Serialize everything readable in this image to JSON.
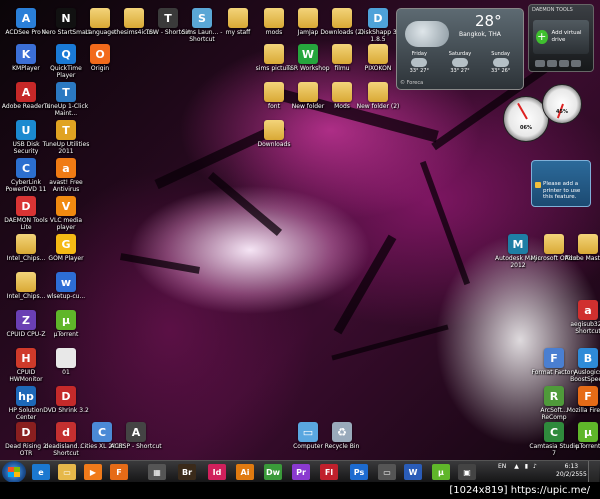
{
  "icons": [
    {
      "label": "ACDSee Pro 4",
      "color": "#2a7fd8",
      "glyph": "A"
    },
    {
      "label": "Nero StartSmart",
      "color": "#111",
      "glyph": "N"
    },
    {
      "label": "Language",
      "color": "folder",
      "glyph": ""
    },
    {
      "label": "thesims4icon",
      "color": "folder",
      "glyph": ""
    },
    {
      "label": "TSW - Shortcut",
      "color": "#3a3a3a",
      "glyph": "T"
    },
    {
      "label": "Sims Laun... - Shortcut",
      "color": "#5aa7d6",
      "glyph": "S"
    },
    {
      "label": "my staff",
      "color": "folder",
      "glyph": ""
    },
    {
      "label": "mods",
      "color": "folder",
      "glyph": ""
    },
    {
      "label": "JamJap",
      "color": "folder",
      "glyph": ""
    },
    {
      "label": "Downloads (2)",
      "color": "folder",
      "glyph": ""
    },
    {
      "label": "DiskShapp 3 1.8.5",
      "color": "#4ea2d9",
      "glyph": "D"
    },
    {
      "label": "KMPlayer",
      "color": "#3b6fd6",
      "glyph": "K"
    },
    {
      "label": "QuickTime Player",
      "color": "#1a7ad6",
      "glyph": "Q"
    },
    {
      "label": "Origin",
      "color": "#f26a1b",
      "glyph": "O"
    },
    {
      "label": "sims picture",
      "color": "folder",
      "glyph": ""
    },
    {
      "label": "TSR Workshop",
      "color": "#26a63d",
      "glyph": "W"
    },
    {
      "label": "filmu",
      "color": "folder",
      "glyph": ""
    },
    {
      "label": "PIXOKON",
      "color": "folder",
      "glyph": ""
    },
    {
      "label": "Adobe Reader X",
      "color": "#c62828",
      "glyph": "A"
    },
    {
      "label": "TuneUp 1-Click Maint...",
      "color": "#2b79c2",
      "glyph": "T"
    },
    {
      "label": "font",
      "color": "folder",
      "glyph": ""
    },
    {
      "label": "New folder",
      "color": "folder",
      "glyph": ""
    },
    {
      "label": "Mods",
      "color": "folder",
      "glyph": ""
    },
    {
      "label": "New folder (2)",
      "color": "folder",
      "glyph": ""
    },
    {
      "label": "USB Disk Security",
      "color": "#1b8ad0",
      "glyph": "U"
    },
    {
      "label": "TuneUp Utilities 2011",
      "color": "#e0a322",
      "glyph": "T"
    },
    {
      "label": "Downloads",
      "color": "folder",
      "glyph": ""
    },
    {
      "label": "CyberLink PowerDVD 11",
      "color": "#2c6fcf",
      "glyph": "C"
    },
    {
      "label": "avast! Free Antivirus",
      "color": "#f07b14",
      "glyph": "a"
    },
    {
      "label": "DAEMON Tools Lite",
      "color": "#d93434",
      "glyph": "D"
    },
    {
      "label": "VLC media player",
      "color": "#f18a10",
      "glyph": "V"
    },
    {
      "label": "Intel_Chips...",
      "color": "folder",
      "glyph": ""
    },
    {
      "label": "GOM Player",
      "color": "#f5b915",
      "glyph": "G"
    },
    {
      "label": "Intel_Chips...",
      "color": "folder",
      "glyph": ""
    },
    {
      "label": "wlsetup-cu...",
      "color": "#2d6ed6",
      "glyph": "w"
    },
    {
      "label": "CPUID CPU-Z",
      "color": "#6a3fb4",
      "glyph": "Z"
    },
    {
      "label": "µTorrent",
      "color": "#5fb62a",
      "glyph": "µ"
    },
    {
      "label": "CPUID HWMonitor",
      "color": "#cf3a2a",
      "glyph": "H"
    },
    {
      "label": "01",
      "color": "#e8e8e8",
      "glyph": ""
    },
    {
      "label": "HP Solution Center",
      "color": "#1d68b8",
      "glyph": "hp"
    },
    {
      "label": "DVD Shrink 3.2",
      "color": "#c42a2a",
      "glyph": "D"
    },
    {
      "label": "Dead Rising 2 OTR",
      "color": "#8a1f1f",
      "glyph": "D"
    },
    {
      "label": "deadisland... - Shortcut",
      "color": "#c43030",
      "glyph": "d"
    },
    {
      "label": "Cities XL 2012",
      "color": "#4b8ad6",
      "glyph": "C"
    },
    {
      "label": "ACRSP - Shortcut",
      "color": "#444",
      "glyph": "A"
    },
    {
      "label": "Computer",
      "color": "#5aa7e0",
      "glyph": "▭"
    },
    {
      "label": "Recycle Bin",
      "color": "#9ab",
      "glyph": "♻"
    },
    {
      "label": "Autodesk Maya 2012",
      "color": "#1e7ea5",
      "glyph": "M"
    },
    {
      "label": "Microsoft Office",
      "color": "folder",
      "glyph": ""
    },
    {
      "label": "Adobe Master...",
      "color": "folder",
      "glyph": ""
    },
    {
      "label": "aegisub32 - Shortcut",
      "color": "#d0302f",
      "glyph": "a"
    },
    {
      "label": "Format Factory",
      "color": "#4a7fd1",
      "glyph": "F"
    },
    {
      "label": "Auslogics BoostSpeed",
      "color": "#2e8bd8",
      "glyph": "B"
    },
    {
      "label": "ArcSoft... ReComp",
      "color": "#4f9a3a",
      "glyph": "R"
    },
    {
      "label": "Mozilla Firefox",
      "color": "#e66b17",
      "glyph": "F"
    },
    {
      "label": "Camtasia Studio 7",
      "color": "#2f8a3c",
      "glyph": "C"
    },
    {
      "label": "µTorrent",
      "color": "#5fb62a",
      "glyph": "µ"
    }
  ],
  "weather": {
    "temperature": "28°",
    "city": "Bangkok, THA",
    "source": "© Foreca",
    "days": [
      {
        "name": "Friday",
        "hi": "33°",
        "lo": "27°"
      },
      {
        "name": "Saturday",
        "hi": "33°",
        "lo": "27°"
      },
      {
        "name": "Sunday",
        "hi": "33°",
        "lo": "26°"
      }
    ]
  },
  "daemon": {
    "header": "DAEMON TOOLS",
    "add_label": "Add virtual drive"
  },
  "gauges": [
    {
      "value": "06%"
    },
    {
      "value": "45%"
    }
  ],
  "printer": {
    "message": "Please add a printer to use this feature."
  },
  "taskbar": {
    "language": "EN",
    "time": "6:13",
    "date": "20/2/2555",
    "pinned": [
      {
        "name": "ie",
        "color": "#1b78d0",
        "glyph": "e"
      },
      {
        "name": "explorer",
        "color": "#e6b84a",
        "glyph": "▭"
      },
      {
        "name": "media-player",
        "color": "#f07a1a",
        "glyph": "▶"
      },
      {
        "name": "firefox",
        "color": "#e66b17",
        "glyph": "F"
      },
      {
        "name": "app-gray",
        "color": "#555",
        "glyph": "▦"
      },
      {
        "name": "bridge",
        "color": "#3a2a1a",
        "glyph": "Br"
      },
      {
        "name": "indesign",
        "color": "#d0205c",
        "glyph": "Id"
      },
      {
        "name": "illustrator",
        "color": "#e07a10",
        "glyph": "Ai"
      },
      {
        "name": "dreamweaver",
        "color": "#3a9a3a",
        "glyph": "Dw"
      },
      {
        "name": "premiere",
        "color": "#8a3ad0",
        "glyph": "Pr"
      },
      {
        "name": "flash",
        "color": "#c0202c",
        "glyph": "Fl"
      },
      {
        "name": "photoshop",
        "color": "#1d6bd0",
        "glyph": "Ps"
      },
      {
        "name": "explorer-2",
        "color": "#555",
        "glyph": "▭"
      },
      {
        "name": "word",
        "color": "#2a5cb8",
        "glyph": "W"
      },
      {
        "name": "utorrent",
        "color": "#5fb62a",
        "glyph": "µ"
      },
      {
        "name": "app-2",
        "color": "#444",
        "glyph": "▣"
      }
    ]
  },
  "watermark": "[1024x819] https://upic.me/"
}
